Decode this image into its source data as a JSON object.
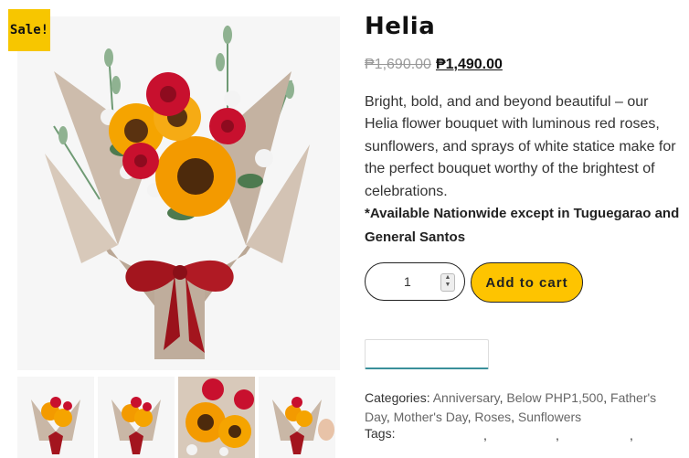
{
  "badge": {
    "sale": "Sale!"
  },
  "product": {
    "title": "Helia",
    "price_old": "₱1,690.00",
    "price_new": "₱1,490.00",
    "description": "Bright, bold, and and beyond beautiful – our Helia flower bouquet with luminous red roses, sunflowers, and sprays of white statice make for the perfect bouquet worthy of the brightest of celebrations.",
    "availability_note": "*Available Nationwide except in Tuguegarao and General Santos"
  },
  "cart": {
    "quantity": "1",
    "add_label": "Add to cart"
  },
  "meta": {
    "categories_label": "Categories:",
    "categories": [
      "Anniversary",
      "Below PHP1,500",
      "Father's Day",
      "Mother's Day",
      "Roses",
      "Sunflowers"
    ],
    "tags_label": "Tags:"
  },
  "colors": {
    "accent": "#fec400",
    "sale_badge": "#f7c600",
    "rose": "#c8102e",
    "sunflower": "#f59b00",
    "wrap": "#c9b7a6",
    "ribbon": "#a3151e"
  }
}
